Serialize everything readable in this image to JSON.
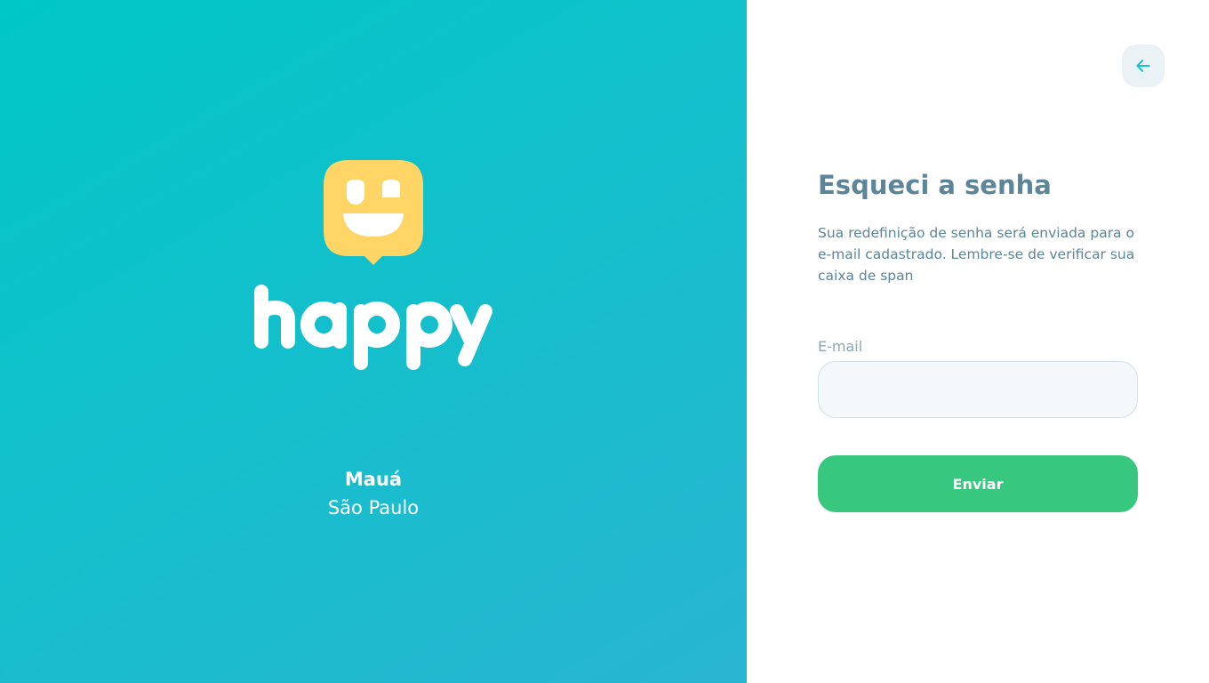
{
  "brand": {
    "logo_name": "happy",
    "logo_color": "#FFD666",
    "city": "Mauá",
    "state": "São Paulo"
  },
  "back_button": {
    "icon": "arrow-left-icon",
    "icon_color": "#15C3D6"
  },
  "form": {
    "title": "Esqueci a senha",
    "description": "Sua redefinição de senha será enviada para o e-mail cadastrado. Lembre-se de verificar sua caixa de span",
    "email_label": "E-mail",
    "email_value": "",
    "submit_label": "Enviar"
  },
  "colors": {
    "gradient_start": "#00C7C7",
    "gradient_end": "#29B6D1",
    "primary_text": "#5C8599",
    "muted_text": "#8FA7B2",
    "button": "#37C77F",
    "input_bg": "#F5F8FA",
    "input_border": "#D3E2E5"
  }
}
